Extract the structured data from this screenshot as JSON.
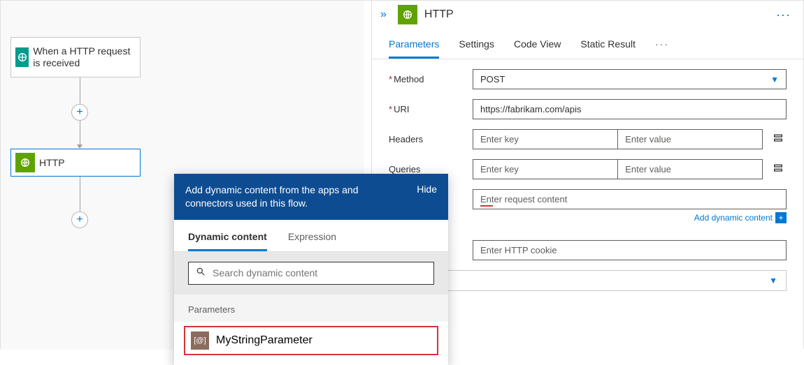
{
  "canvas": {
    "trigger_node_label": "When a HTTP request is received",
    "http_node_label": "HTTP"
  },
  "panel": {
    "title": "HTTP",
    "tabs": {
      "parameters": "Parameters",
      "settings": "Settings",
      "code_view": "Code View",
      "static_result": "Static Result",
      "more": "···"
    },
    "labels": {
      "method": "Method",
      "uri": "URI",
      "headers": "Headers",
      "queries": "Queries"
    },
    "method_value": "POST",
    "uri_value": "https://fabrikam.com/apis",
    "placeholders": {
      "enter_key": "Enter key",
      "enter_value": "Enter value",
      "body": "Enter request content",
      "cookie": "Enter HTTP cookie"
    },
    "add_dynamic_label": "Add dynamic content"
  },
  "popup": {
    "message": "Add dynamic content from the apps and connectors used in this flow.",
    "hide_label": "Hide",
    "tabs": {
      "dynamic": "Dynamic content",
      "expression": "Expression"
    },
    "search_placeholder": "Search dynamic content",
    "group_label": "Parameters",
    "parameter_name": "MyStringParameter"
  }
}
